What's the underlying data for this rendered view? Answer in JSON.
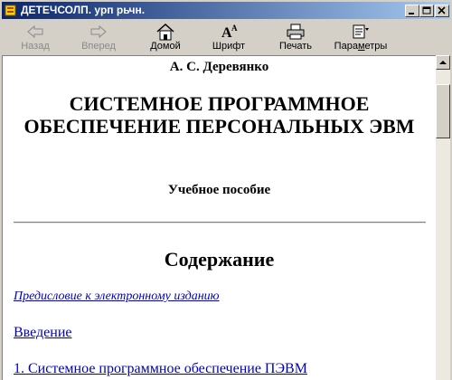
{
  "window": {
    "title": "ДЕТЕЧСОЛП. урп рьчн."
  },
  "toolbar": {
    "back_label": "Назад",
    "forward_label": "Вперед",
    "home_label": "Домой",
    "font_label": "Шрифт",
    "print_label": "Печать",
    "options_prefix": "Пара",
    "options_hotkey": "м",
    "options_suffix": "етры"
  },
  "document": {
    "author": "А. С. Деревянко",
    "title": "СИСТЕМНОЕ ПРОГРАММНОЕ ОБЕСПЕЧЕНИЕ ПЕРСОНАЛЬНЫХ ЭВМ",
    "subtitle": "Учебное пособие",
    "toc_heading": "Содержание",
    "toc": [
      "Предисловие к электронному изданию",
      "Введение",
      "1. Системное программное обеспечение ПЭВМ"
    ]
  },
  "colors": {
    "titlebar_start": "#0a246a",
    "titlebar_end": "#a6caf0",
    "link": "#0000c0"
  }
}
